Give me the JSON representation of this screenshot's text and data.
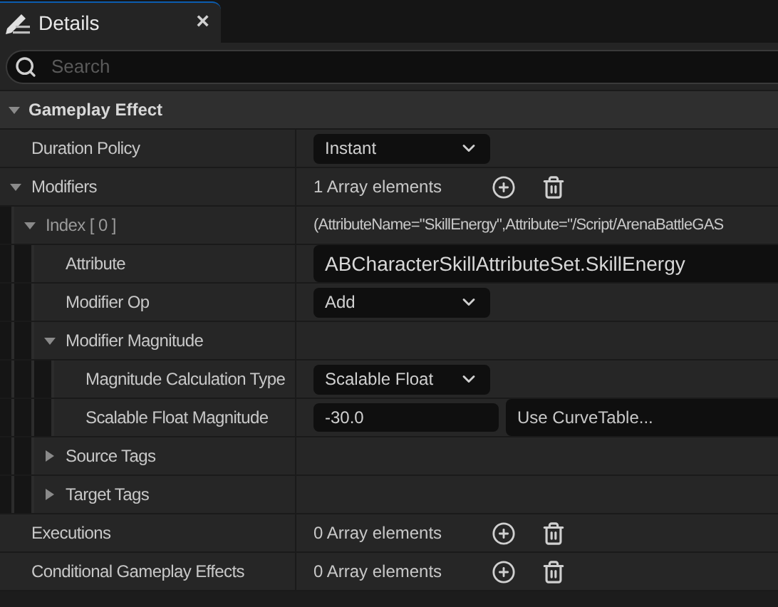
{
  "tab": {
    "title": "Details",
    "close": "×"
  },
  "search": {
    "placeholder": "Search"
  },
  "category": {
    "title": "Gameplay Effect",
    "expanded": true
  },
  "rows": [
    {
      "label": "Duration Policy",
      "kind": "dropdown",
      "value": "Instant"
    },
    {
      "label": "Modifiers",
      "kind": "array",
      "value": "1 Array elements",
      "expanded": true,
      "children": [
        {
          "label": "Index [ 0 ]",
          "kind": "text",
          "value": "(AttributeName=\"SkillEnergy\",Attribute=\"/Script/ArenaBattleGAS",
          "expanded": true,
          "children": [
            {
              "label": "Attribute",
              "kind": "field",
              "value": "ABCharacterSkillAttributeSet.SkillEnergy"
            },
            {
              "label": "Modifier Op",
              "kind": "dropdown",
              "value": "Add"
            },
            {
              "label": "Modifier Magnitude",
              "kind": "none",
              "expanded": true,
              "children": [
                {
                  "label": "Magnitude Calculation Type",
                  "kind": "dropdown",
                  "value": "Scalable Float"
                },
                {
                  "label": "Scalable Float Magnitude",
                  "kind": "curve",
                  "value": "-30.0",
                  "curve": "Use CurveTable..."
                }
              ]
            },
            {
              "label": "Source Tags",
              "kind": "none",
              "expanded": false
            },
            {
              "label": "Target Tags",
              "kind": "none",
              "expanded": false
            }
          ]
        }
      ]
    },
    {
      "label": "Executions",
      "kind": "array",
      "value": "0 Array elements"
    },
    {
      "label": "Conditional Gameplay Effects",
      "kind": "array",
      "value": "0 Array elements"
    }
  ]
}
